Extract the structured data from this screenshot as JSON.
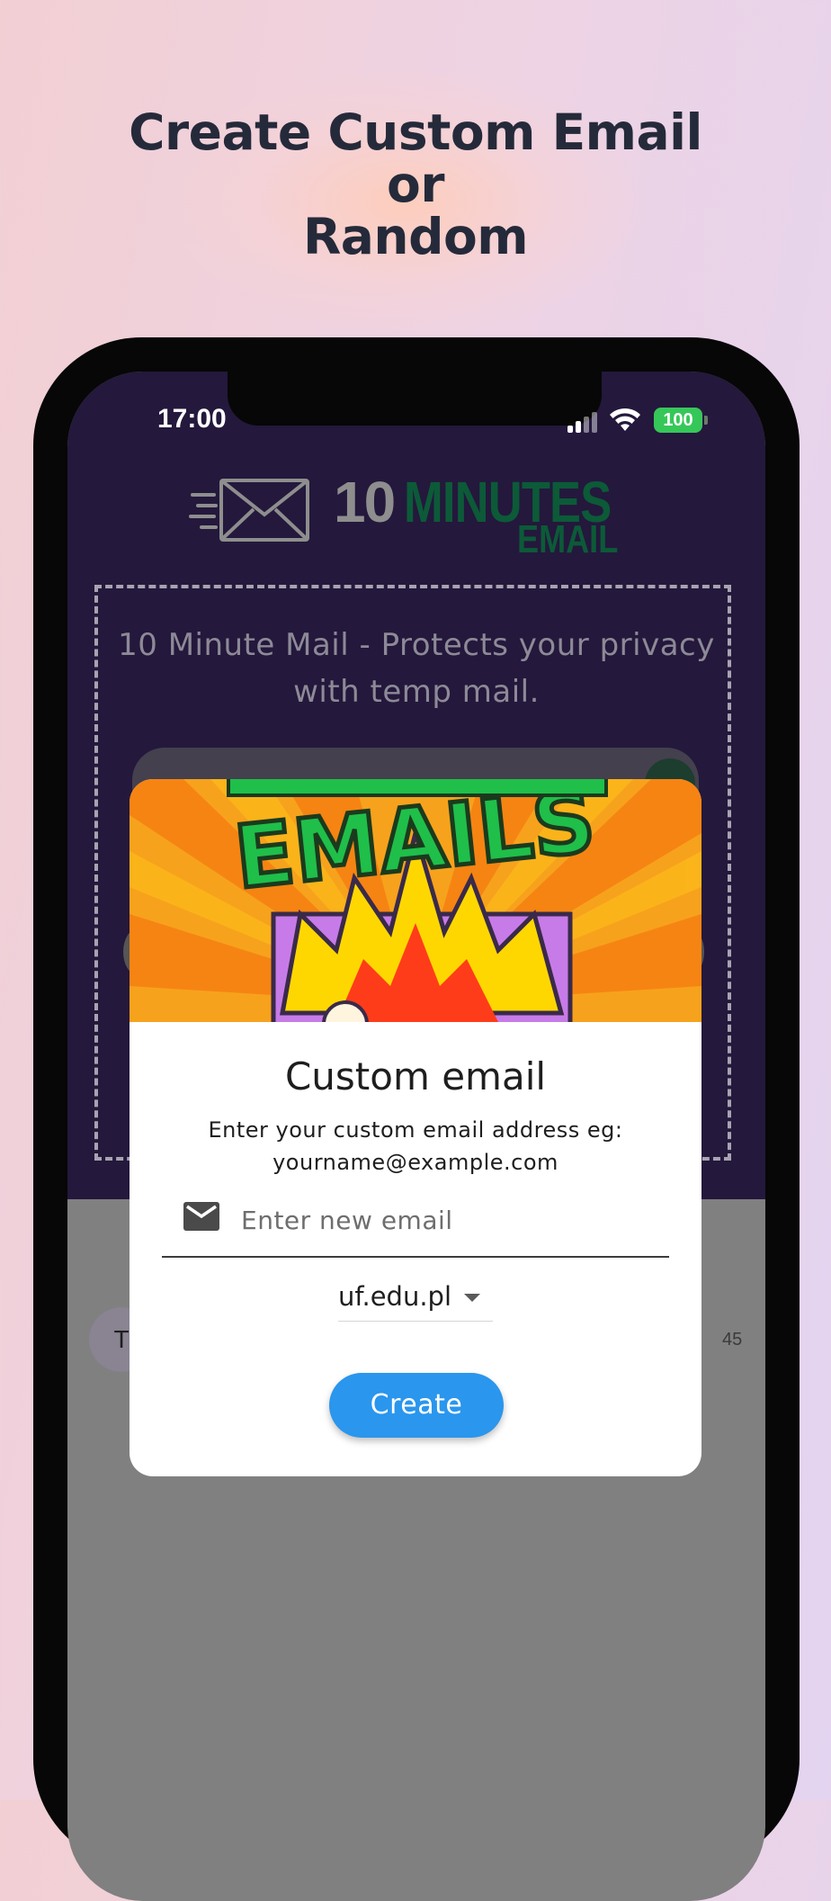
{
  "headline": {
    "line1": "Create Custom Email",
    "line2": "or",
    "line3": "Random"
  },
  "status_bar": {
    "time": "17:00",
    "battery": "100"
  },
  "app": {
    "logo_number": "10",
    "logo_minutes": "MINUTES",
    "logo_email": "EMAIL",
    "tagline": "10 Minute Mail - Protects your privacy with temp mail.",
    "list_avatar_letter": "T",
    "list_time_fragment": "45"
  },
  "dialog": {
    "title": "Custom email",
    "description": "Enter your custom email address eg: yourname@example.com",
    "email_placeholder": "Enter new email",
    "email_value": "",
    "domain_selected": "uf.edu.pl",
    "create_label": "Create",
    "banner_text": "EMAILS"
  },
  "colors": {
    "app_background": "#24183c",
    "accent_button": "#2a96ed",
    "logo_green": "#0c5a38",
    "battery_green": "#36c759"
  }
}
